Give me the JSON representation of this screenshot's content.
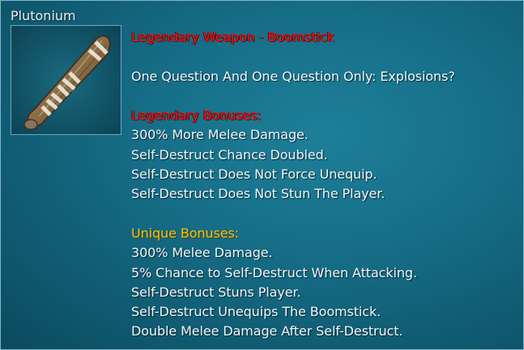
{
  "item": {
    "name": "Plutonium",
    "icon": "taped-club-icon"
  },
  "header": {
    "title": "Legendary Weapon - Boomstick",
    "flavor": "One Question And One Question Only: Explosions?"
  },
  "legendary_bonuses": {
    "heading": "Legendary Bonuses:",
    "lines": [
      "300% More Melee Damage.",
      "Self-Destruct Chance Doubled.",
      "Self-Destruct Does Not Force Unequip.",
      "Self-Destruct Does Not Stun The Player."
    ]
  },
  "unique_bonuses": {
    "heading": "Unique Bonuses:",
    "lines": [
      "300% Melee Damage.",
      "5% Chance to Self-Destruct When Attacking.",
      "Self-Destruct Stuns Player.",
      "Self-Destruct Unequips The Boomstick.",
      "Double Melee Damage After Self-Destruct."
    ]
  },
  "colors": {
    "legendary": "#e8191b",
    "unique": "#f0c419",
    "text": "#f2f6f7",
    "panel": "#17708a"
  }
}
